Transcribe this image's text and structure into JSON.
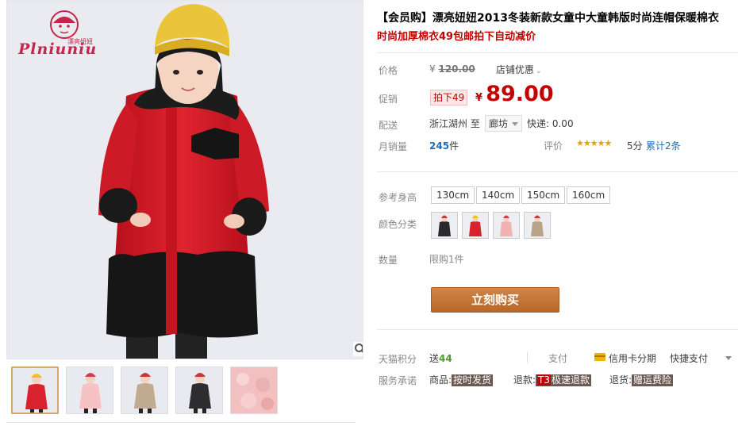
{
  "brand": {
    "logo_script": "Plniuniu",
    "logo_cn": "漂亮妞妞"
  },
  "product": {
    "title": "【会员购】漂亮妞妞2013冬装新款女童中大童韩版时尚连帽保暖棉衣",
    "subtitle": "时尚加厚棉衣49包邮拍下自动减价"
  },
  "price": {
    "label": "价格",
    "currency": "¥",
    "original": "120.00",
    "shop_promo_label": "店铺优惠",
    "chevron": "⌄"
  },
  "promo": {
    "label": "促销",
    "tag": "拍下49",
    "currency": "¥",
    "price": "89.00"
  },
  "shipping": {
    "label": "配送",
    "from": "浙江湖州",
    "to_word": "至",
    "destination": "廊坊",
    "express": "快递: 0.00"
  },
  "sales": {
    "label": "月销量",
    "count": "245",
    "unit": "件",
    "rating_label": "评价",
    "stars": "★★★★★",
    "score": "5分",
    "reviews": "累计2条"
  },
  "sizes": {
    "label": "参考身高",
    "options": [
      "130cm",
      "140cm",
      "150cm",
      "160cm"
    ]
  },
  "colors": {
    "label": "颜色分类",
    "options": [
      {
        "name": "black",
        "coat": "#2a2a2e",
        "hat": "#c33a3a"
      },
      {
        "name": "red",
        "coat": "#d8222e",
        "hat": "#f0c020"
      },
      {
        "name": "pink",
        "coat": "#f2b2b4",
        "hat": "#d04050"
      },
      {
        "name": "khaki",
        "coat": "#b9a48a",
        "hat": "#c33a3a"
      }
    ]
  },
  "quantity": {
    "label": "数量",
    "limit": "限购1件"
  },
  "buy_button": {
    "label": "立刻购买"
  },
  "points": {
    "label": "天猫积分",
    "prefix": "送",
    "value": "44"
  },
  "payment": {
    "label": "支付",
    "credit": "信用卡分期",
    "fast": "快捷支付"
  },
  "promises": {
    "label": "服务承诺",
    "goods_prefix": "商品:",
    "goods_tag": "按时发货",
    "refund_prefix": "退款:",
    "refund_t3": "T3",
    "refund_tag": "极速退款",
    "return_prefix": "退货:",
    "return_tag": "赠运费险"
  },
  "thumbnails": [
    {
      "name": "red-coat",
      "coat": "#d8222e",
      "hat": "#f0c020",
      "active": true
    },
    {
      "name": "pink-coat",
      "coat": "#f6c2c4",
      "hat": "#d04050",
      "active": false
    },
    {
      "name": "khaki-coat",
      "coat": "#c0ab90",
      "hat": "#c33a3a",
      "active": false
    },
    {
      "name": "black-coat",
      "coat": "#2d2d30",
      "hat": "#c33a3a",
      "active": false
    },
    {
      "name": "fur-detail",
      "coat": "#f2c0c0",
      "hat": "#f2c0c0",
      "active": false
    }
  ],
  "colors_theme": {
    "accent_red": "#c40000",
    "link_blue": "#1a6ebd",
    "button_brown": "#c0702c"
  }
}
